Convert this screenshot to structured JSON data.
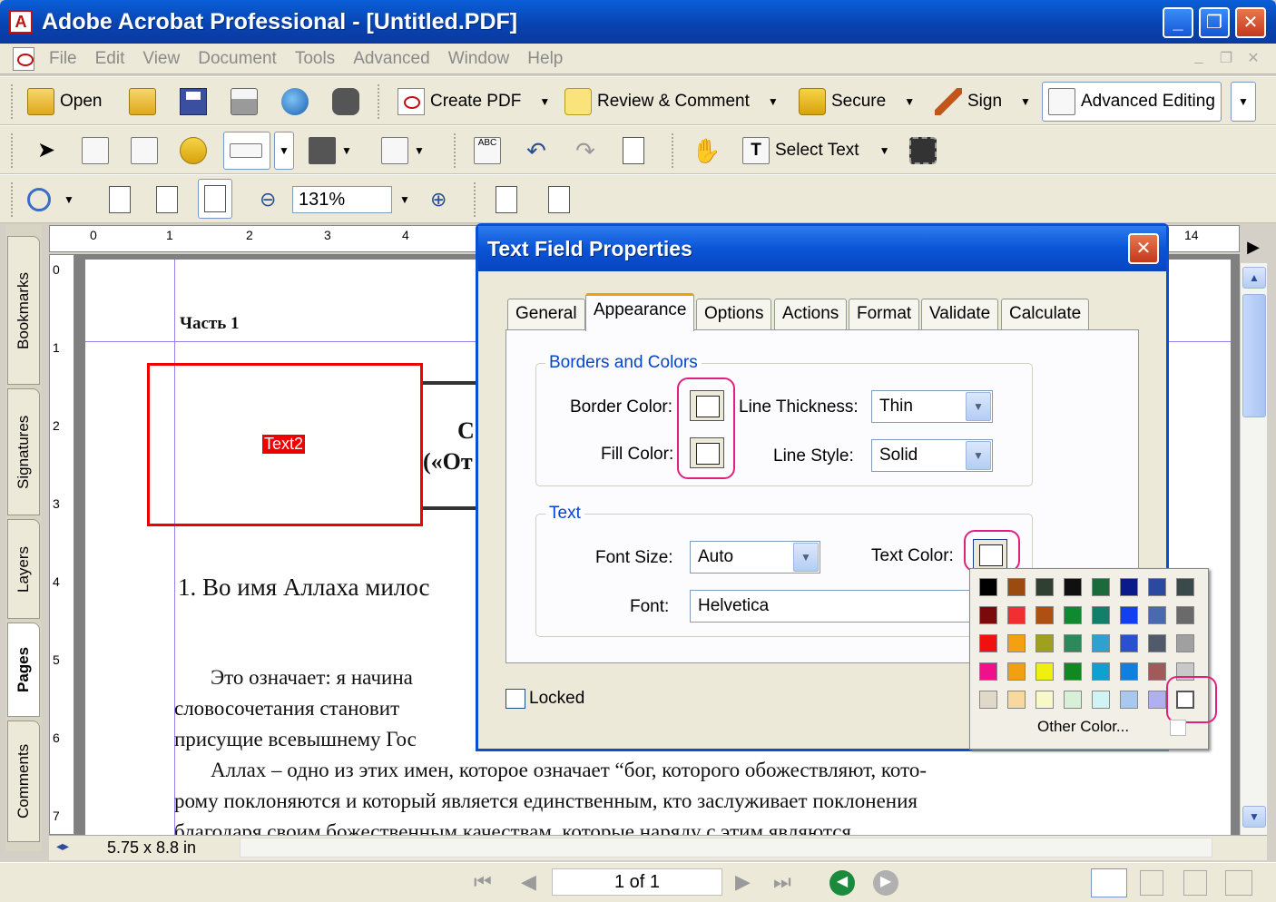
{
  "window": {
    "title": "Adobe Acrobat Professional - [Untitled.PDF]"
  },
  "menu": [
    "File",
    "Edit",
    "View",
    "Document",
    "Tools",
    "Advanced",
    "Window",
    "Help"
  ],
  "toolbar": {
    "open": "Open",
    "create_pdf": "Create PDF",
    "review_comment": "Review & Comment",
    "secure": "Secure",
    "sign": "Sign",
    "advanced_editing": "Advanced Editing",
    "select_text": "Select Text",
    "zoom": "131%"
  },
  "nav_tabs": [
    "Bookmarks",
    "Signatures",
    "Layers",
    "Pages",
    "Comments"
  ],
  "ruler": {
    "top": [
      "0",
      "1",
      "2",
      "3",
      "4",
      "14"
    ],
    "left": [
      "0",
      "1",
      "2",
      "3",
      "4",
      "5",
      "6",
      "7"
    ]
  },
  "document": {
    "heading": "Часть 1",
    "field_label": "Text2",
    "fragment_1": "С",
    "fragment_2": "(«От",
    "line_1": "1. Во имя Аллаха милос",
    "para_1a": "Это означает: я начина",
    "para_1b": "словосочетания   становит",
    "para_1c": "присущие всевышнему Гос",
    "para_2a": "Аллах – одно из этих имен, которое означает “бог, которого обожествляют, кото-",
    "para_2b": "рому поклоняются и который является единственным, кто заслуживает поклонения",
    "para_2c": "благодаря  своим  божественным  качествам,  которые  наряду  с  этим  являются"
  },
  "info": {
    "page_size": "5.75 x 8.8 in"
  },
  "status": {
    "page_indicator": "1 of 1"
  },
  "dialog": {
    "title": "Text Field Properties",
    "tabs": [
      "General",
      "Appearance",
      "Options",
      "Actions",
      "Format",
      "Validate",
      "Calculate"
    ],
    "active_tab": "Appearance",
    "borders_group": "Borders and Colors",
    "border_color_label": "Border Color:",
    "fill_color_label": "Fill Color:",
    "line_thickness_label": "Line Thickness:",
    "line_thickness_value": "Thin",
    "line_style_label": "Line Style:",
    "line_style_value": "Solid",
    "text_group": "Text",
    "font_size_label": "Font Size:",
    "font_size_value": "Auto",
    "text_color_label": "Text Color:",
    "font_label": "Font:",
    "font_value": "Helvetica",
    "locked_label": "Locked"
  },
  "palette": {
    "other_color": "Other Color...",
    "rows": [
      [
        "#000000",
        "#9b4a10",
        "#2f3f30",
        "#101010",
        "#1a6a3a",
        "#0a1a8a",
        "#2a4aa0",
        "#3a4a4a"
      ],
      [
        "#7a0a0a",
        "#f03030",
        "#b05010",
        "#108a30",
        "#10806a",
        "#1040f0",
        "#4a6ab0",
        "#6a6a6a"
      ],
      [
        "#f01010",
        "#f4a010",
        "#a0a020",
        "#2a8a5a",
        "#30a0d0",
        "#2a50d0",
        "#505a6a",
        "#a0a0a0"
      ],
      [
        "#f0108a",
        "#f0a010",
        "#f0f010",
        "#108a20",
        "#10a0d0",
        "#1080e0",
        "#a05a5a",
        "#c8c8c8"
      ],
      [
        "#e0d8c8",
        "#f8d8a0",
        "#f8f8c8",
        "#d8f0d8",
        "#d0f4f4",
        "#a8c8f0",
        "#b0b0f0",
        "#ffffff"
      ]
    ]
  }
}
